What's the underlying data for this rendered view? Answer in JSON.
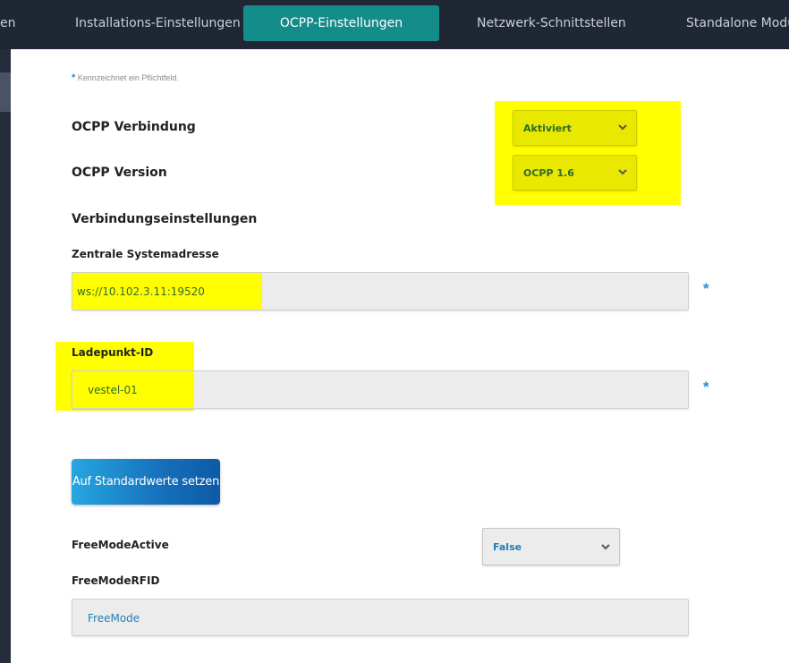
{
  "nav": {
    "tabs": [
      {
        "label": "en"
      },
      {
        "label": "Installations-Einstellungen"
      },
      {
        "label": "OCPP-Einstellungen"
      },
      {
        "label": "Netzwerk-Schnittstellen"
      },
      {
        "label": "Standalone Modus"
      }
    ],
    "active_tab": "OCPP-Einstellungen"
  },
  "form": {
    "required_star": "*",
    "required_note": "Kennzeichnet ein Pflichtfeld.",
    "ocpp_connection": {
      "label": "OCPP Verbindung",
      "value": "Aktiviert"
    },
    "ocpp_version": {
      "label": "OCPP Version",
      "value": "OCPP 1.6"
    },
    "connection_settings_heading": "Verbindungseinstellungen",
    "central_system_address": {
      "label": "Zentrale Systemadresse",
      "value": "ws://10.102.3.11:19520",
      "required_marker": "*"
    },
    "charge_point_id": {
      "label": "Ladepunkt-ID",
      "value": "vestel-01",
      "required_marker": "*"
    },
    "reset_button": "Auf Standardwerte setzen",
    "free_mode_active": {
      "label": "FreeModeActive",
      "value": "False"
    },
    "free_mode_rfid": {
      "label": "FreeModeRFID",
      "value": "FreeMode"
    }
  },
  "colors": {
    "nav_bg": "#1f2634",
    "active_tab": "#138c8a",
    "highlight": "#ffff00",
    "required_marker": "#1f8fd6",
    "value_text": "#1f7fb8"
  },
  "icons": {
    "dropdown": "chevron-down-icon"
  }
}
